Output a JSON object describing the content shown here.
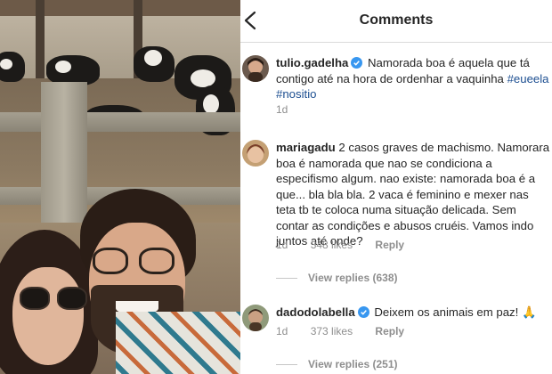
{
  "header": {
    "title": "Comments"
  },
  "comments": [
    {
      "username": "tulio.gadelha",
      "verified": true,
      "text": "Namorada boa é aquela que tá contigo até na hora de ordenhar a vaquinha",
      "hashtags": "#eueela #nositio",
      "time": "1d"
    },
    {
      "username": "mariagadu",
      "verified": false,
      "text": "2 casos graves de machismo. Namorara boa é namorada que nao se condiciona a especifismo algum. nao existe: namorada boa é a que... bla bla bla. 2 vaca é feminino e mexer nas teta tb te coloca numa situação delicada. Sem contar as condições e abusos cruéis. Vamos indo juntos até onde?",
      "time": "1d",
      "likes": "348 likes",
      "reply_label": "Reply",
      "view_replies": "View replies (638)"
    },
    {
      "username": "dadodolabella",
      "verified": true,
      "text": "Deixem os animais em paz! 🙏",
      "time": "1d",
      "likes": "373 likes",
      "reply_label": "Reply",
      "view_replies": "View replies (251)"
    }
  ],
  "colors": {
    "verified": "#3897f0",
    "hashtag": "#1d4f91",
    "meta": "#8e8e8e"
  }
}
